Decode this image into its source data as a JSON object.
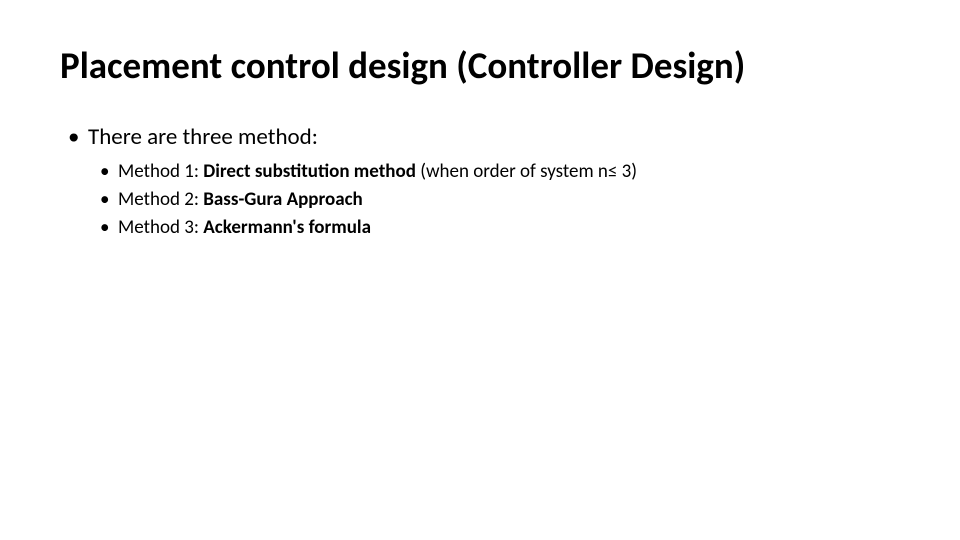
{
  "title": "Placement control design (Controller Design)",
  "intro": "There are three method:",
  "methods": [
    {
      "prefix": "Method 1: ",
      "name": "Direct substitution method ",
      "suffix": "(when order of system n≤ 3)"
    },
    {
      "prefix": "Method 2: ",
      "name": "Bass-Gura Approach",
      "suffix": ""
    },
    {
      "prefix": "Method 3: ",
      "name": "Ackermann's formula",
      "suffix": ""
    }
  ]
}
